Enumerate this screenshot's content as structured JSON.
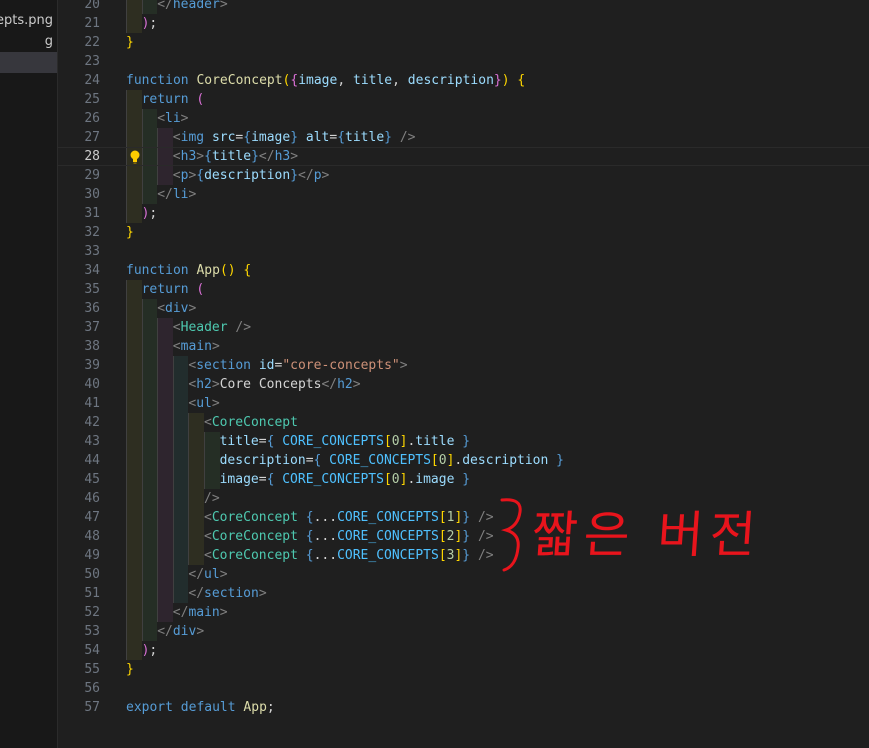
{
  "sidebar": {
    "items": [
      {
        "label": "cepts.png",
        "selected": false
      },
      {
        "label": "g",
        "selected": false
      },
      {
        "label": "",
        "selected": true
      }
    ]
  },
  "editor": {
    "current_line": 28,
    "lines": [
      {
        "n": "20",
        "tokens": [
          [
            "punct",
            "</"
          ],
          [
            "tag",
            "header"
          ],
          [
            "punct",
            ">"
          ]
        ]
      },
      {
        "n": "21",
        "tokens": [
          [
            "b2",
            ")"
          ],
          [
            "txt",
            ";"
          ]
        ]
      },
      {
        "n": "22",
        "tokens": [
          [
            "b1",
            "}"
          ]
        ]
      },
      {
        "n": "23",
        "tokens": []
      },
      {
        "n": "24",
        "tokens": [
          [
            "kw",
            "function"
          ],
          [
            "txt",
            " "
          ],
          [
            "fn",
            "CoreConcept"
          ],
          [
            "b1",
            "("
          ],
          [
            "b2",
            "{"
          ],
          [
            "var",
            "image"
          ],
          [
            "txt",
            ", "
          ],
          [
            "var",
            "title"
          ],
          [
            "txt",
            ", "
          ],
          [
            "var",
            "description"
          ],
          [
            "b2",
            "}"
          ],
          [
            "b1",
            ")"
          ],
          [
            "txt",
            " "
          ],
          [
            "b1",
            "{"
          ]
        ]
      },
      {
        "n": "25",
        "tokens": [
          [
            "kw",
            "return"
          ],
          [
            "txt",
            " "
          ],
          [
            "b2",
            "("
          ]
        ]
      },
      {
        "n": "26",
        "tokens": [
          [
            "punct",
            "<"
          ],
          [
            "tag",
            "li"
          ],
          [
            "punct",
            ">"
          ]
        ]
      },
      {
        "n": "27",
        "tokens": [
          [
            "punct",
            "<"
          ],
          [
            "tag",
            "img"
          ],
          [
            "txt",
            " "
          ],
          [
            "var",
            "src"
          ],
          [
            "txt",
            "="
          ],
          [
            "kw",
            "{"
          ],
          [
            "var",
            "image"
          ],
          [
            "kw",
            "}"
          ],
          [
            "txt",
            " "
          ],
          [
            "var",
            "alt"
          ],
          [
            "txt",
            "="
          ],
          [
            "kw",
            "{"
          ],
          [
            "var",
            "title"
          ],
          [
            "kw",
            "}"
          ],
          [
            "txt",
            " "
          ],
          [
            "punct",
            "/>"
          ]
        ]
      },
      {
        "n": "28",
        "tokens": [
          [
            "punct",
            "<"
          ],
          [
            "tag",
            "h3"
          ],
          [
            "punct",
            ">"
          ],
          [
            "kw",
            "{"
          ],
          [
            "var",
            "title"
          ],
          [
            "kw",
            "}"
          ],
          [
            "punct",
            "</"
          ],
          [
            "tag",
            "h3"
          ],
          [
            "punct",
            ">"
          ]
        ]
      },
      {
        "n": "29",
        "tokens": [
          [
            "punct",
            "<"
          ],
          [
            "tag",
            "p"
          ],
          [
            "punct",
            ">"
          ],
          [
            "kw",
            "{"
          ],
          [
            "var",
            "description"
          ],
          [
            "kw",
            "}"
          ],
          [
            "punct",
            "</"
          ],
          [
            "tag",
            "p"
          ],
          [
            "punct",
            ">"
          ]
        ]
      },
      {
        "n": "30",
        "tokens": [
          [
            "punct",
            "</"
          ],
          [
            "tag",
            "li"
          ],
          [
            "punct",
            ">"
          ]
        ]
      },
      {
        "n": "31",
        "tokens": [
          [
            "b2",
            ")"
          ],
          [
            "txt",
            ";"
          ]
        ]
      },
      {
        "n": "32",
        "tokens": [
          [
            "b1",
            "}"
          ]
        ]
      },
      {
        "n": "33",
        "tokens": []
      },
      {
        "n": "34",
        "tokens": [
          [
            "kw",
            "function"
          ],
          [
            "txt",
            " "
          ],
          [
            "fn",
            "App"
          ],
          [
            "b1",
            "()"
          ],
          [
            "txt",
            " "
          ],
          [
            "b1",
            "{"
          ]
        ]
      },
      {
        "n": "35",
        "tokens": [
          [
            "kw",
            "return"
          ],
          [
            "txt",
            " "
          ],
          [
            "b2",
            "("
          ]
        ]
      },
      {
        "n": "36",
        "tokens": [
          [
            "punct",
            "<"
          ],
          [
            "tag",
            "div"
          ],
          [
            "punct",
            ">"
          ]
        ]
      },
      {
        "n": "37",
        "tokens": [
          [
            "punct",
            "<"
          ],
          [
            "comp",
            "Header"
          ],
          [
            "txt",
            " "
          ],
          [
            "punct",
            "/>"
          ]
        ]
      },
      {
        "n": "38",
        "tokens": [
          [
            "punct",
            "<"
          ],
          [
            "tag",
            "main"
          ],
          [
            "punct",
            ">"
          ]
        ]
      },
      {
        "n": "39",
        "tokens": [
          [
            "punct",
            "<"
          ],
          [
            "tag",
            "section"
          ],
          [
            "txt",
            " "
          ],
          [
            "var",
            "id"
          ],
          [
            "txt",
            "="
          ],
          [
            "str",
            "\"core-concepts\""
          ],
          [
            "punct",
            ">"
          ]
        ]
      },
      {
        "n": "40",
        "tokens": [
          [
            "punct",
            "<"
          ],
          [
            "tag",
            "h2"
          ],
          [
            "punct",
            ">"
          ],
          [
            "txt",
            "Core Concepts"
          ],
          [
            "punct",
            "</"
          ],
          [
            "tag",
            "h2"
          ],
          [
            "punct",
            ">"
          ]
        ]
      },
      {
        "n": "41",
        "tokens": [
          [
            "punct",
            "<"
          ],
          [
            "tag",
            "ul"
          ],
          [
            "punct",
            ">"
          ]
        ]
      },
      {
        "n": "42",
        "tokens": [
          [
            "punct",
            "<"
          ],
          [
            "comp",
            "CoreConcept"
          ]
        ]
      },
      {
        "n": "43",
        "tokens": [
          [
            "var",
            "title"
          ],
          [
            "txt",
            "="
          ],
          [
            "kw",
            "{"
          ],
          [
            "txt",
            " "
          ],
          [
            "const",
            "CORE_CONCEPTS"
          ],
          [
            "b1",
            "["
          ],
          [
            "num",
            "0"
          ],
          [
            "b1",
            "]"
          ],
          [
            "txt",
            "."
          ],
          [
            "var",
            "title"
          ],
          [
            "txt",
            " "
          ],
          [
            "kw",
            "}"
          ]
        ]
      },
      {
        "n": "44",
        "tokens": [
          [
            "var",
            "description"
          ],
          [
            "txt",
            "="
          ],
          [
            "kw",
            "{"
          ],
          [
            "txt",
            " "
          ],
          [
            "const",
            "CORE_CONCEPTS"
          ],
          [
            "b1",
            "["
          ],
          [
            "num",
            "0"
          ],
          [
            "b1",
            "]"
          ],
          [
            "txt",
            "."
          ],
          [
            "var",
            "description"
          ],
          [
            "txt",
            " "
          ],
          [
            "kw",
            "}"
          ]
        ]
      },
      {
        "n": "45",
        "tokens": [
          [
            "var",
            "image"
          ],
          [
            "txt",
            "="
          ],
          [
            "kw",
            "{"
          ],
          [
            "txt",
            " "
          ],
          [
            "const",
            "CORE_CONCEPTS"
          ],
          [
            "b1",
            "["
          ],
          [
            "num",
            "0"
          ],
          [
            "b1",
            "]"
          ],
          [
            "txt",
            "."
          ],
          [
            "var",
            "image"
          ],
          [
            "txt",
            " "
          ],
          [
            "kw",
            "}"
          ]
        ]
      },
      {
        "n": "46",
        "tokens": [
          [
            "punct",
            "/>"
          ]
        ]
      },
      {
        "n": "47",
        "tokens": [
          [
            "punct",
            "<"
          ],
          [
            "comp",
            "CoreConcept"
          ],
          [
            "txt",
            " "
          ],
          [
            "kw",
            "{"
          ],
          [
            "txt",
            "..."
          ],
          [
            "const",
            "CORE_CONCEPTS"
          ],
          [
            "b1",
            "["
          ],
          [
            "num",
            "1"
          ],
          [
            "b1",
            "]"
          ],
          [
            "kw",
            "}"
          ],
          [
            "txt",
            " "
          ],
          [
            "punct",
            "/>"
          ]
        ]
      },
      {
        "n": "48",
        "tokens": [
          [
            "punct",
            "<"
          ],
          [
            "comp",
            "CoreConcept"
          ],
          [
            "txt",
            " "
          ],
          [
            "kw",
            "{"
          ],
          [
            "txt",
            "..."
          ],
          [
            "const",
            "CORE_CONCEPTS"
          ],
          [
            "b1",
            "["
          ],
          [
            "num",
            "2"
          ],
          [
            "b1",
            "]"
          ],
          [
            "kw",
            "}"
          ],
          [
            "txt",
            " "
          ],
          [
            "punct",
            "/>"
          ]
        ]
      },
      {
        "n": "49",
        "tokens": [
          [
            "punct",
            "<"
          ],
          [
            "comp",
            "CoreConcept"
          ],
          [
            "txt",
            " "
          ],
          [
            "kw",
            "{"
          ],
          [
            "txt",
            "..."
          ],
          [
            "const",
            "CORE_CONCEPTS"
          ],
          [
            "b1",
            "["
          ],
          [
            "num",
            "3"
          ],
          [
            "b1",
            "]"
          ],
          [
            "kw",
            "}"
          ],
          [
            "txt",
            " "
          ],
          [
            "punct",
            "/>"
          ]
        ]
      },
      {
        "n": "50",
        "tokens": [
          [
            "punct",
            "</"
          ],
          [
            "tag",
            "ul"
          ],
          [
            "punct",
            ">"
          ]
        ]
      },
      {
        "n": "51",
        "tokens": [
          [
            "punct",
            "</"
          ],
          [
            "tag",
            "section"
          ],
          [
            "punct",
            ">"
          ]
        ]
      },
      {
        "n": "52",
        "tokens": [
          [
            "punct",
            "</"
          ],
          [
            "tag",
            "main"
          ],
          [
            "punct",
            ">"
          ]
        ]
      },
      {
        "n": "53",
        "tokens": [
          [
            "punct",
            "</"
          ],
          [
            "tag",
            "div"
          ],
          [
            "punct",
            ">"
          ]
        ]
      },
      {
        "n": "54",
        "tokens": [
          [
            "b2",
            ")"
          ],
          [
            "txt",
            ";"
          ]
        ]
      },
      {
        "n": "55",
        "tokens": [
          [
            "b1",
            "}"
          ]
        ]
      },
      {
        "n": "56",
        "tokens": []
      },
      {
        "n": "57",
        "tokens": [
          [
            "kw",
            "export"
          ],
          [
            "txt",
            " "
          ],
          [
            "kw",
            "default"
          ],
          [
            "txt",
            " "
          ],
          [
            "fn",
            "App"
          ],
          [
            "txt",
            ";"
          ]
        ]
      }
    ]
  },
  "annotation": {
    "text": "짧은 버전",
    "color": "#e8141c"
  },
  "colors": {
    "background": "#1f1f1f",
    "keyword": "#569cd6",
    "function": "#dcdcaa",
    "variable": "#9cdcfe",
    "component": "#4ec9b0",
    "string": "#ce9178",
    "lightbulb": "#ffcc00"
  }
}
